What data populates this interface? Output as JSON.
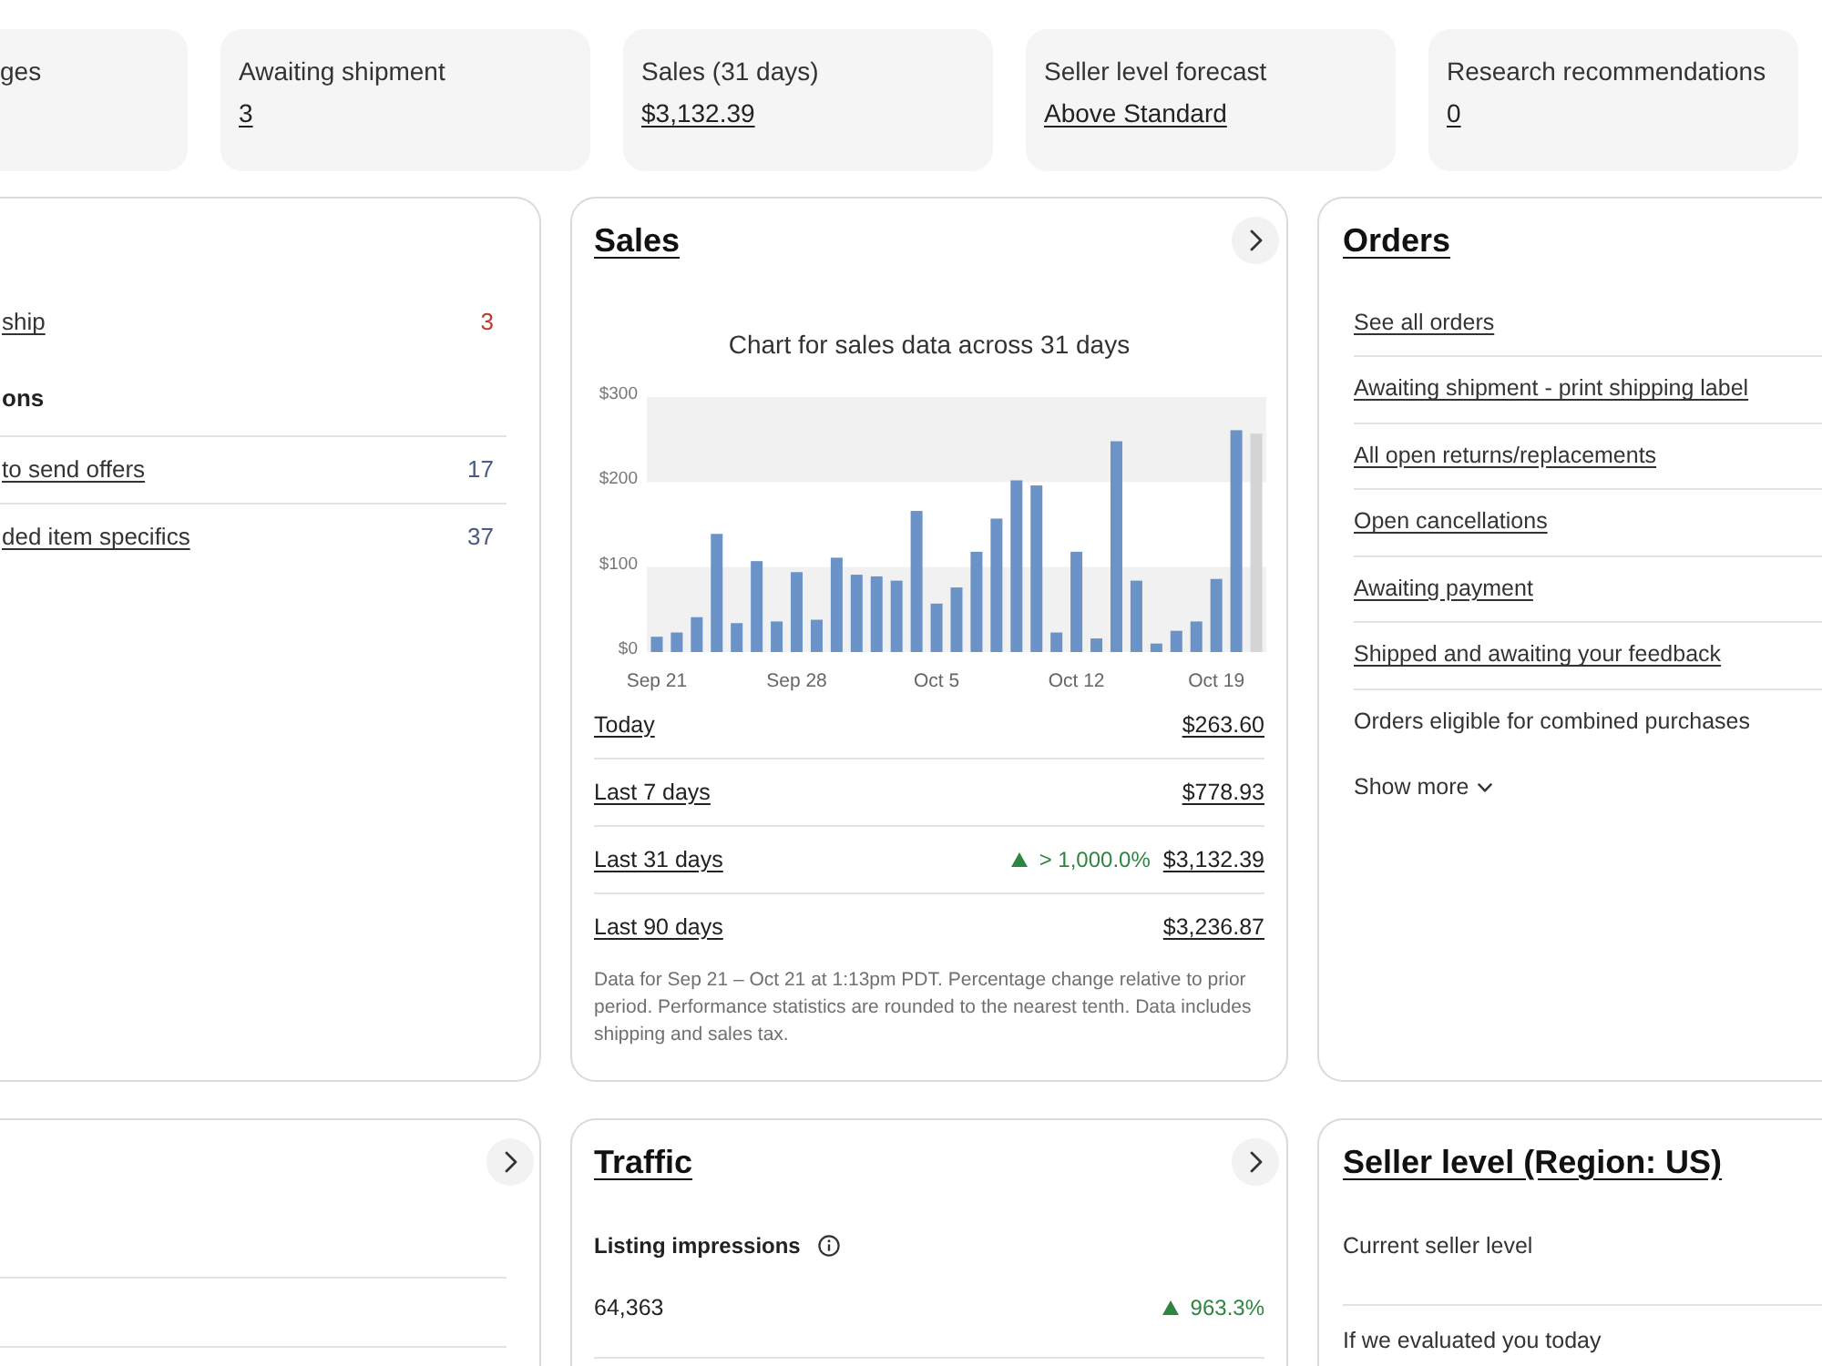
{
  "stat_tiles": [
    {
      "label": "ges"
    },
    {
      "label": "Awaiting shipment",
      "value": "3"
    },
    {
      "label": "Sales (31 days)",
      "value": "$3,132.39"
    },
    {
      "label": "Seller level forecast",
      "value": "Above Standard"
    },
    {
      "label": "Research recommendations",
      "value": "0"
    }
  ],
  "task_card": {
    "rows": [
      {
        "kind": "link",
        "label": "ship",
        "count": "3",
        "alert": true
      },
      {
        "kind": "heading",
        "label": "ons"
      },
      {
        "kind": "link",
        "label": "to send offers",
        "count": "17",
        "alert": false
      },
      {
        "kind": "link",
        "label": "ded item specifics",
        "count": "37",
        "alert": false
      }
    ]
  },
  "sales": {
    "title": "Sales",
    "chart_data": {
      "type": "bar",
      "title": "Chart for sales data across 31 days",
      "categories": [
        "Sep 21",
        null,
        null,
        null,
        null,
        null,
        null,
        "Sep 28",
        null,
        null,
        null,
        null,
        null,
        null,
        "Oct 5",
        null,
        null,
        null,
        null,
        null,
        null,
        "Oct 12",
        null,
        null,
        null,
        null,
        null,
        null,
        "Oct 19",
        null,
        null
      ],
      "series": [
        {
          "color": "#6b93c8",
          "values": [
            18,
            23,
            41,
            139,
            34,
            107,
            36,
            94,
            38,
            111,
            91,
            89,
            84,
            166,
            57,
            76,
            118,
            157,
            202,
            196,
            23,
            118,
            16,
            248,
            84,
            10,
            25,
            36,
            86,
            261,
            null
          ]
        },
        {
          "color": "#d4d4d4",
          "values": [
            null,
            null,
            null,
            null,
            null,
            null,
            null,
            null,
            null,
            null,
            null,
            null,
            null,
            null,
            null,
            null,
            null,
            null,
            null,
            null,
            null,
            null,
            null,
            null,
            null,
            null,
            null,
            null,
            null,
            null,
            257
          ]
        }
      ],
      "ylim": [
        0,
        300
      ],
      "yticks": [
        {
          "value": 0,
          "label": "$0"
        },
        {
          "value": 100,
          "label": "$100"
        },
        {
          "value": 200,
          "label": "$200"
        },
        {
          "value": 300,
          "label": "$300"
        }
      ]
    },
    "rows": [
      {
        "label": "Today",
        "amount": "$263.60"
      },
      {
        "label": "Last 7 days",
        "amount": "$778.93"
      },
      {
        "label": "Last 31 days",
        "change": {
          "up": true,
          "text": "> 1,000.0%"
        },
        "amount": "$3,132.39"
      },
      {
        "label": "Last 90 days",
        "amount": "$3,236.87"
      }
    ],
    "note": "Data for Sep 21 – Oct 21 at 1:13pm PDT. Percentage change relative to prior period. Performance statistics are rounded to the nearest tenth. Data includes shipping and sales tax."
  },
  "orders": {
    "title": "Orders",
    "items": [
      {
        "label": "See all orders",
        "link": true
      },
      {
        "label": "Awaiting shipment - print shipping label",
        "link": true
      },
      {
        "label": "All open returns/replacements",
        "link": true
      },
      {
        "label": "Open cancellations",
        "link": true
      },
      {
        "label": "Awaiting payment",
        "link": true
      },
      {
        "label": "Shipped and awaiting your feedback",
        "link": true
      },
      {
        "label": "Orders eligible for combined purchases",
        "link": false
      }
    ],
    "show_more": "Show more"
  },
  "traffic": {
    "title": "Traffic",
    "metrics": [
      {
        "label": "Listing impressions",
        "value": "64,363",
        "change": {
          "up": true,
          "text": "963.3%"
        }
      }
    ]
  },
  "seller_level": {
    "title": "Seller level (Region: US)",
    "rows": [
      "Current seller level",
      "If we evaluated you today"
    ]
  }
}
